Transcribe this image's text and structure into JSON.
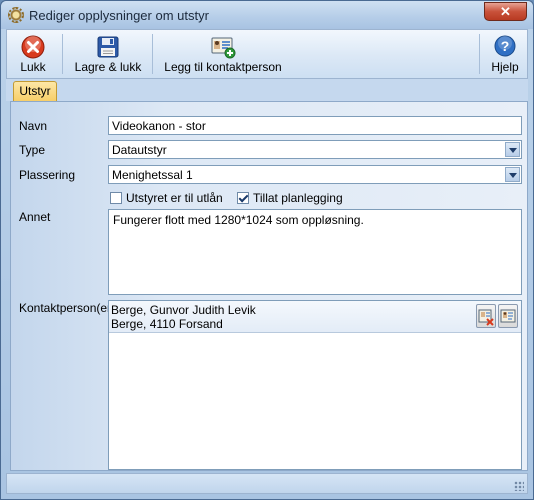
{
  "window": {
    "title": "Rediger opplysninger om utstyr",
    "close_glyph": "✕"
  },
  "toolbar": {
    "close_label": "Lukk",
    "save_close_label": "Lagre & lukk",
    "add_contact_label": "Legg til kontaktperson",
    "help_label": "Hjelp"
  },
  "tabs": [
    {
      "label": "Utstyr",
      "selected": true
    }
  ],
  "form": {
    "name_label": "Navn",
    "name_value": "Videokanon - stor",
    "type_label": "Type",
    "type_value": "Datautstyr",
    "location_label": "Plassering",
    "location_value": "Menighetssal 1",
    "loan_checkbox_label": "Utstyret er til utlån",
    "loan_checked": false,
    "planning_checkbox_label": "Tillat planlegging",
    "planning_checked": true,
    "other_label": "Annet",
    "other_value": "Fungerer flott med 1280*1024 som oppløsning.",
    "contacts_label": "Kontaktperson(er)",
    "contacts": [
      {
        "name": "Berge, Gunvor  Judith Levik",
        "address": "Berge, 4110 Forsand"
      }
    ]
  },
  "icons": {
    "close": "close-icon",
    "save": "floppy-disk-icon",
    "add_contact": "add-contact-card-icon",
    "help": "help-icon",
    "remove_contact": "remove-contact-icon",
    "edit_contact": "contact-card-icon"
  },
  "colors": {
    "close_red": "#d83a1e",
    "help_blue": "#2f6fc4",
    "tab_active": "#f7cd65",
    "window_blue": "#bcd3ea"
  }
}
